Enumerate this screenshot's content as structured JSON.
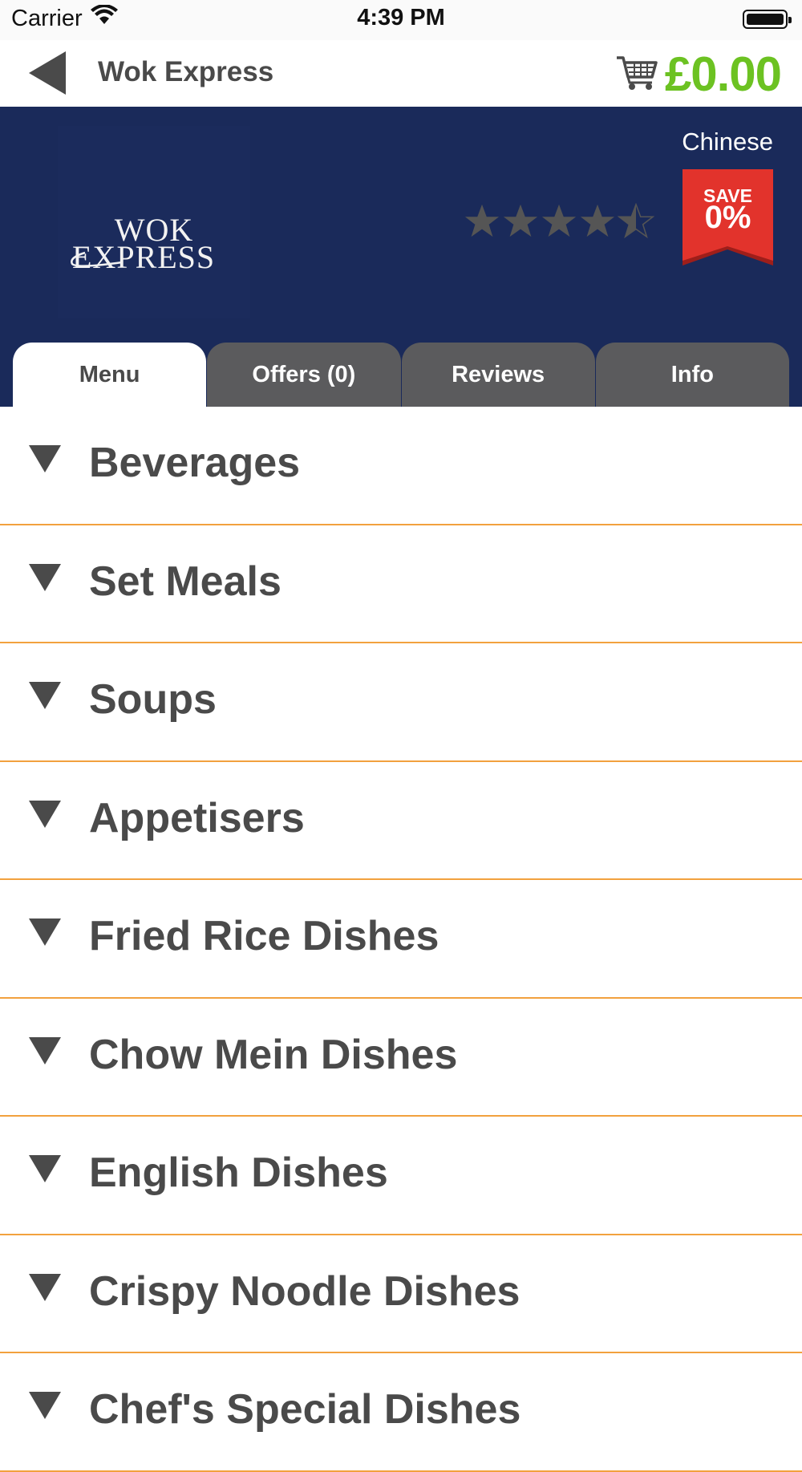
{
  "status_bar": {
    "carrier": "Carrier",
    "time": "4:39 PM"
  },
  "nav": {
    "title": "Wok Express",
    "cart_total": "£0.00"
  },
  "restaurant": {
    "logo_line1": "WOK",
    "logo_line2": "EXPRESS",
    "cuisine": "Chinese",
    "rating": 4.5,
    "save_label": "SAVE",
    "save_value": "0%"
  },
  "tabs": [
    {
      "label": "Menu",
      "active": true
    },
    {
      "label": "Offers (0)",
      "active": false
    },
    {
      "label": "Reviews",
      "active": false
    },
    {
      "label": "Info",
      "active": false
    }
  ],
  "menu": {
    "categories": [
      "Beverages",
      "Set Meals",
      "Soups",
      "Appetisers",
      "Fried Rice Dishes",
      "Chow Mein Dishes",
      "English Dishes",
      "Crispy Noodle Dishes",
      "Chef's Special Dishes"
    ]
  },
  "colors": {
    "banner": "#1a2a5a",
    "cart_total": "#6cc222",
    "divider": "#f2a13e",
    "ribbon": "#e2332c",
    "tab_inactive": "#5b5b5d"
  }
}
